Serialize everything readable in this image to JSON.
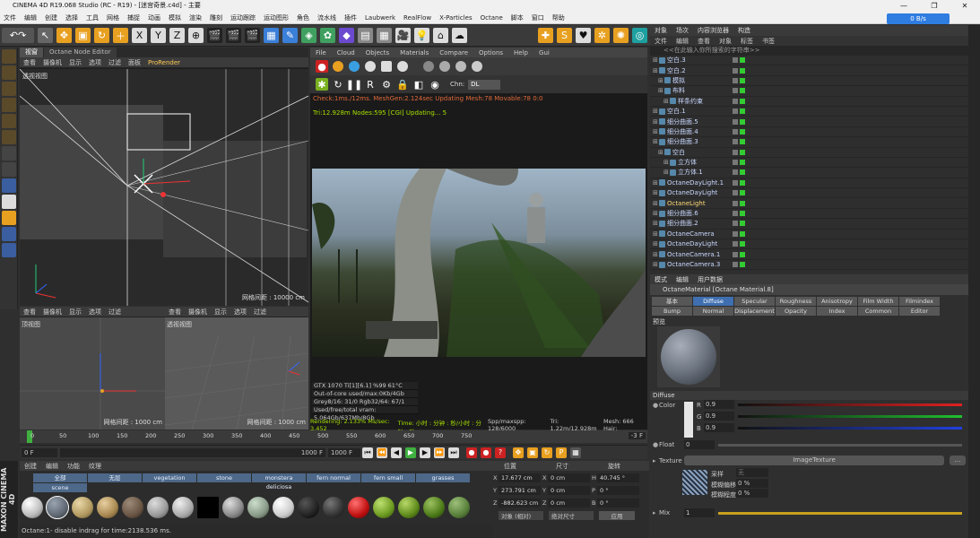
{
  "title": "CINEMA 4D R19.068 Studio (RC - R19) - [迷宫奇景.c4d] - 主要",
  "menu": [
    "文件",
    "编辑",
    "创建",
    "选择",
    "工具",
    "网格",
    "捕捉",
    "动画",
    "模拟",
    "渲染",
    "雕刻",
    "运动跟踪",
    "运动图形",
    "角色",
    "流水线",
    "插件",
    "Laubwerk",
    "RealFlow",
    "X-Particles",
    "Octane",
    "脚本",
    "窗口",
    "帮助"
  ],
  "net_speed": "0 B/s",
  "viewport_main": {
    "tabs": [
      "视窗",
      "Octane Node Editor"
    ],
    "menu": [
      "查看",
      "摄像机",
      "显示",
      "选项",
      "过滤",
      "面板",
      "ProRender"
    ],
    "label": "透视视图",
    "footer": "网格间距 : 10000 cm"
  },
  "viewport_top": {
    "menu": [
      "查看",
      "摄像机",
      "显示",
      "选项",
      "过滤"
    ],
    "label": "顶视图",
    "footer": "网格间距 : 1000 cm"
  },
  "viewport_front": {
    "menu": [
      "查看",
      "摄像机",
      "显示",
      "选项",
      "过滤"
    ],
    "label": "透视视图",
    "footer": "网格间距 : 1000 cm"
  },
  "octane": {
    "menu": [
      "File",
      "Cloud",
      "Objects",
      "Materials",
      "Compare",
      "Options",
      "Help",
      "Gui"
    ],
    "channel_label": "Chn:",
    "channel_value": "DL",
    "status1": "Check:1ms./12ms. MeshGen:2.124sec Updating Mesh:78 Movable:78 0:0",
    "status2": "Tri:12.928m Nodes:595  [CGI] Updating...   5",
    "stats": [
      "GTX 1070 Ti[1][6.1]          %99     61°C",
      "Out-of-core used/max:0Kb/4Gb",
      "Grey8/16: 31/0         Rgb32/64: 67/1",
      "Used/free/total vram: 5.064Gb/637Mb/8Gb"
    ],
    "render_bar": [
      "Rendering: 2.133%  Ms/sec: 3.452",
      "Time: 小时 : 分钟 : 秒/小时 : 分钟 : 秒",
      "Spp/maxspp: 128/6000",
      "Tri: 1.22m/12.928m",
      "Mesh: 666  Hair:"
    ]
  },
  "timeline": {
    "ticks": [
      "0",
      "50",
      "100",
      "150",
      "200",
      "250",
      "300",
      "350",
      "400",
      "450",
      "500",
      "550",
      "600",
      "650",
      "700",
      "750"
    ],
    "frame_start": "0 F",
    "frame_end": "1000 F",
    "frame_end2": "1000 F",
    "current": "-3 F"
  },
  "object_manager": {
    "tabs": [
      "对象",
      "场次",
      "内容浏览器",
      "构造"
    ],
    "menu": [
      "文件",
      "编辑",
      "查看",
      "对象",
      "标签",
      "书签"
    ],
    "search": "<<在此输入你所搜索的字符串>>",
    "objects": [
      {
        "name": "空白.3",
        "light": false
      },
      {
        "name": "空白.2",
        "light": false
      },
      {
        "name": "模拟",
        "light": false
      },
      {
        "name": "布料",
        "light": false
      },
      {
        "name": "样条约束",
        "light": false
      },
      {
        "name": "空白.1",
        "light": false
      },
      {
        "name": "细分曲面.5",
        "light": false
      },
      {
        "name": "细分曲面.4",
        "light": false
      },
      {
        "name": "细分曲面.3",
        "light": false
      },
      {
        "name": "空白",
        "light": false
      },
      {
        "name": "立方体",
        "light": false
      },
      {
        "name": "立方体.1",
        "light": false
      },
      {
        "name": "OctaneDayLight.1",
        "light": false
      },
      {
        "name": "OctaneDayLight",
        "light": false
      },
      {
        "name": "OctaneLight",
        "light": true
      },
      {
        "name": "细分曲面.6",
        "light": false
      },
      {
        "name": "细分曲面.2",
        "light": false
      },
      {
        "name": "OctaneCamera",
        "light": false
      },
      {
        "name": "OctaneDayLight",
        "light": false
      },
      {
        "name": "OctaneCamera.1",
        "light": false
      },
      {
        "name": "OctaneCamera.3",
        "light": false
      }
    ]
  },
  "attributes": {
    "tabs": [
      "模式",
      "编辑",
      "用户数据"
    ],
    "title": "OctaneMaterial [Octane Material.8]",
    "mat_tabs": [
      "基本",
      "Diffuse",
      "Specular",
      "Roughness",
      "Anisotropy",
      "Film Width",
      "Filmindex",
      "Bump",
      "Normal",
      "Displacement",
      "Opacity",
      "Index",
      "Common",
      "Editor"
    ],
    "active_tab": "Diffuse",
    "preview_label": "预览",
    "section": "Diffuse",
    "color_label": "Color",
    "r_label": "R",
    "r_value": "0.9",
    "g_label": "G",
    "g_value": "0.9",
    "b_label": "B",
    "b_value": "0.9",
    "float_label": "Float",
    "float_value": "0",
    "texture_label": "Texture",
    "texture_button": "ImageTexture",
    "sample_label": "采样",
    "sample_value": "无",
    "blur_offset_label": "模糊偏移",
    "blur_offset_value": "0 %",
    "blur_scale_label": "模糊程度",
    "blur_scale_value": "0 %",
    "mix_label": "Mix",
    "mix_value": "1"
  },
  "materials": {
    "menu": [
      "创建",
      "编辑",
      "功能",
      "纹理"
    ],
    "layers": [
      "全部",
      "无层",
      "vegetation",
      "stone",
      "monstera deliciosa",
      "fern normal",
      "fern small",
      "grasses",
      "scene"
    ]
  },
  "coords": {
    "headers": [
      "位置",
      "尺寸",
      "旋转"
    ],
    "x": "17.677 cm",
    "y": "273.791 cm",
    "z": "-882.623 cm",
    "sx": "0 cm",
    "sy": "0 cm",
    "sz": "0 cm",
    "h": "40.745 °",
    "p": "0 °",
    "b": "0 °",
    "mode1": "对象 (相对)",
    "mode2": "绝对尺寸",
    "apply": "应用"
  },
  "status": "Octane:1- disable indrag for time:2138.536 ms.",
  "brand": "MAXON CINEMA 4D"
}
